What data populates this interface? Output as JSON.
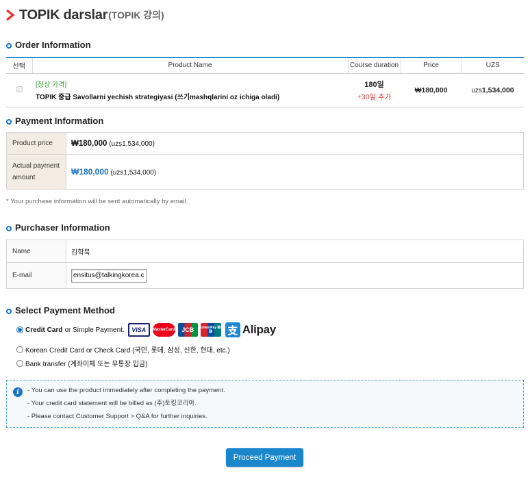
{
  "page": {
    "title_main": "TOPIK darslar",
    "title_sub": "(TOPIK 강의)"
  },
  "order": {
    "section_title": "Order Information",
    "columns": [
      "선택",
      "Product Name",
      "Course duration",
      "Price",
      "UZS"
    ],
    "row": {
      "tag": "[정상 가격]",
      "product_name": "TOPIK 중급 Savollarni yechish strategiyasi (쓰기mashqlarini oz ichiga oladi)",
      "duration": "180일",
      "duration_extra": "+30일 추가",
      "price": "₩180,000",
      "uzs_prefix": "uzs",
      "uzs_amount": "1,534,000"
    }
  },
  "payment_info": {
    "section_title": "Payment Information",
    "product_price_label": "Product price",
    "product_price": "₩180,000",
    "product_price_uzs": "(uzs1,534,000)",
    "actual_label_1": "Actual payment",
    "actual_label_2": "amount",
    "actual_amount": "₩180,000",
    "actual_amount_uzs": "(uzs1,534,000)",
    "note": "* Your purchase information will be sent automatically by email."
  },
  "purchaser": {
    "section_title": "Purchaser Information",
    "name_label": "Name",
    "name_value": "김학묵",
    "email_label": "E-mail",
    "email_value": "ensitus@talkingkorea.c"
  },
  "payment_method": {
    "section_title": "Select Payment Method",
    "option1_bold": "Credit Card",
    "option1_rest": "or Simple Payment.",
    "option2": "Korean Credit Card or Check Card (국민, 롯데, 삼성, 신한, 현대, etc.)",
    "option3": "Bank transfer (계좌이체 또는 무통장 입금)",
    "cards": {
      "visa": "VISA",
      "mastercard": "MasterCard",
      "jcb": "JCB",
      "unionpay": "UnionPay 银联",
      "alipay_logo": "支",
      "alipay": "Alipay"
    }
  },
  "notice": {
    "lines": [
      "- You can use the product immediately after completing the payment.",
      "- Your credit card statement will be billed as (주)토킹코리아.",
      "- Please contact Customer Support > Q&A for further inquiries."
    ]
  },
  "actions": {
    "proceed_label": "Proceed Payment"
  }
}
